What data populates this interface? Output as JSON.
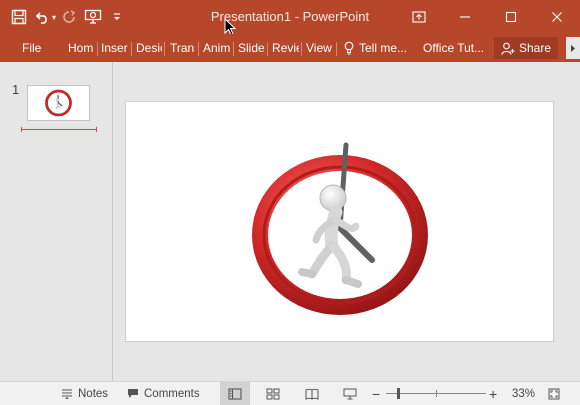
{
  "window": {
    "title": "Presentation1 - PowerPoint"
  },
  "quick_access": {
    "icons": [
      "save-icon",
      "undo-icon",
      "redo-icon",
      "start-from-beginning-icon",
      "customize-qat-icon"
    ]
  },
  "window_controls": {
    "icons": [
      "ribbon-display-options-icon",
      "minimize-icon",
      "maximize-icon",
      "close-icon"
    ]
  },
  "ribbon": {
    "file": "File",
    "tabs": [
      "Hom",
      "Inser",
      "Desic",
      "Trans",
      "Anim",
      "Slide",
      "Revie",
      "View"
    ],
    "tell_me": "Tell me...",
    "office_tut": "Office Tut...",
    "share": "Share"
  },
  "thumbnails": {
    "slide_number": "1"
  },
  "slide": {
    "content": "animated-clock-runner"
  },
  "statusbar": {
    "notes": "Notes",
    "comments": "Comments",
    "zoom_level": "33%",
    "zoom_fraction": 0.33
  },
  "colors": {
    "accent": "#b7472a",
    "clock_red": "#d42a2a"
  }
}
